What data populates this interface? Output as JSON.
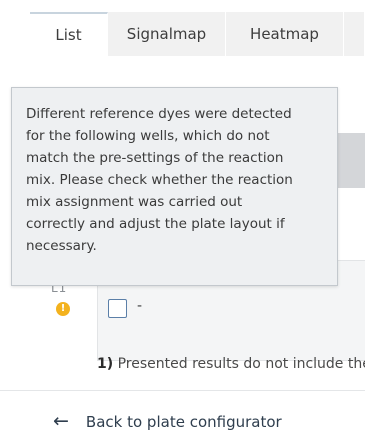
{
  "tabs": [
    {
      "label": "List",
      "active": true
    },
    {
      "label": "Signalmap",
      "active": false
    },
    {
      "label": "Heatmap",
      "active": false
    }
  ],
  "tooltip": {
    "lines": [
      "Different reference dyes were detected",
      "for the following wells, which do not",
      "match the pre-settings of the reaction",
      "mix. Please check whether the reaction",
      "mix assignment was carried out",
      "correctly and adjust the plate layout if",
      "necessary."
    ]
  },
  "well": {
    "label": "L1",
    "value": "-",
    "warning_icon": "warning-icon",
    "warning_color": "#f3b21e"
  },
  "footnote": {
    "number": "1)",
    "text": " Presented results do not include the"
  },
  "back_link": {
    "arrow_icon": "arrow-left-icon",
    "label": "Back to plate configurator"
  }
}
